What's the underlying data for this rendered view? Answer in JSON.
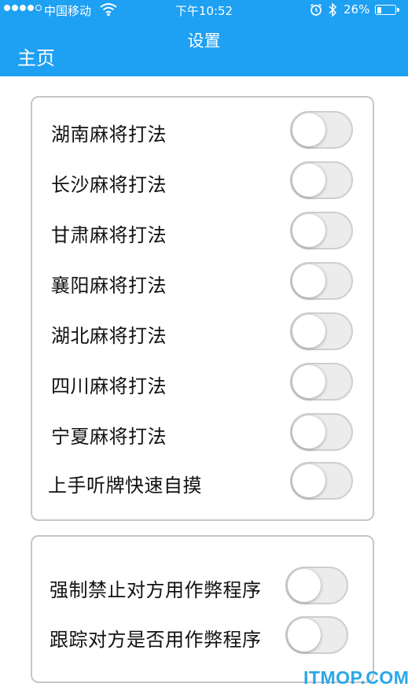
{
  "status_bar": {
    "carrier": "中国移动",
    "time": "下午10:52",
    "battery_percent": "26%",
    "battery_level": 0.26,
    "signal_bars_filled": 4,
    "signal_bars_total": 5,
    "icons": [
      "signal-dots-icon",
      "wifi-icon",
      "alarm-clock-icon",
      "bluetooth-icon",
      "battery-icon"
    ]
  },
  "nav": {
    "title": "设置",
    "back_label": "主页"
  },
  "colors": {
    "header_bg": "#1ea0f3",
    "watermark": "#2aa7e8"
  },
  "group1": {
    "items": [
      {
        "label": "湖南麻将打法",
        "on": false
      },
      {
        "label": "长沙麻将打法",
        "on": false
      },
      {
        "label": "甘肃麻将打法",
        "on": false
      },
      {
        "label": "襄阳麻将打法",
        "on": false
      },
      {
        "label": "湖北麻将打法",
        "on": false
      },
      {
        "label": "四川麻将打法",
        "on": false
      },
      {
        "label": "宁夏麻将打法",
        "on": false
      },
      {
        "label": "上手听牌快速自摸",
        "on": false
      }
    ]
  },
  "group2": {
    "items": [
      {
        "label": "强制禁止对方用作弊程序",
        "on": false
      },
      {
        "label": "跟踪对方是否用作弊程序",
        "on": false
      }
    ]
  },
  "watermark": "ITMOP.COM"
}
